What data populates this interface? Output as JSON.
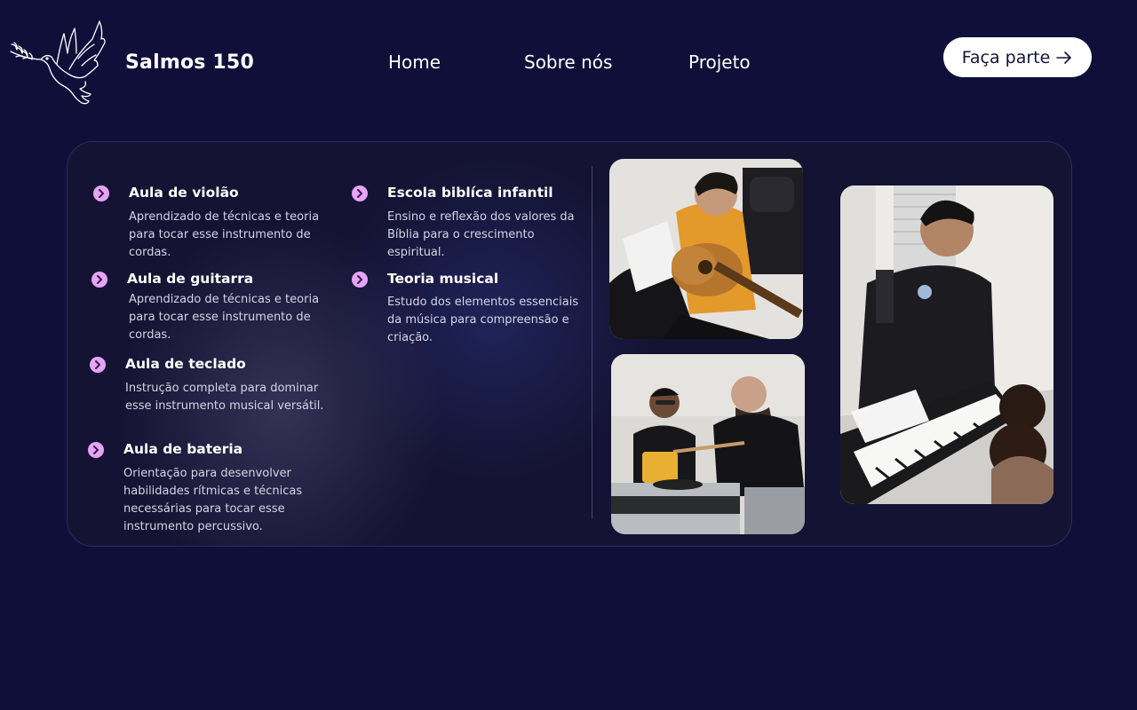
{
  "header": {
    "brand": "Salmos 150",
    "nav": {
      "home": "Home",
      "about": "Sobre nós",
      "project": "Projeto"
    },
    "cta_label": "Faça parte"
  },
  "services": {
    "violao": {
      "title": "Aula de violão",
      "desc": "Aprendizado de técnicas e teoria para tocar esse instrumento de cordas."
    },
    "guitarra": {
      "title": "Aula de guitarra",
      "desc": "Aprendizado de técnicas e teoria para tocar esse instrumento de cordas."
    },
    "teclado": {
      "title": "Aula de teclado",
      "desc": "Instrução completa para dominar esse instrumento musical versátil."
    },
    "bateria": {
      "title": "Aula de bateria",
      "desc": "Orientação para desenvolver habilidades rítmicas e técnicas necessárias para tocar esse instrumento percussivo."
    },
    "escola": {
      "title": "Escola biblíca infantil",
      "desc": "Ensino e reflexão dos valores da Bíblia para o crescimento espiritual."
    },
    "teoria": {
      "title": "Teoria musical",
      "desc": "Estudo dos elementos essenciais da música para compreensão e criação."
    }
  },
  "icons": {
    "logo": "dove-with-olive-branch-icon",
    "bullet": "chevron-right-icon",
    "cta": "arrow-right-icon"
  },
  "colors": {
    "background": "#100f3a",
    "card": "#141333",
    "bullet": "#e6a4f5",
    "cta_bg": "#ffffff",
    "cta_text": "#14133a"
  }
}
